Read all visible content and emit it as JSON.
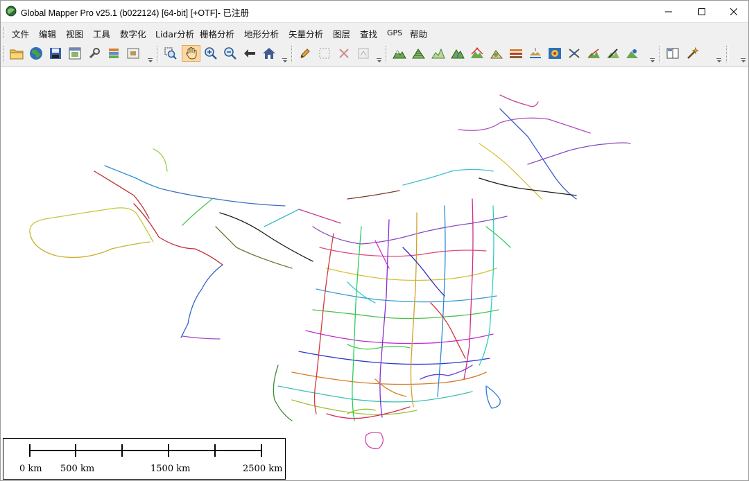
{
  "window": {
    "title": "Global Mapper Pro v25.1 (b022124) [64-bit] [+OTF]- 已注册",
    "controls": [
      "minimize-icon",
      "maximize-icon",
      "close-icon"
    ]
  },
  "menu": {
    "items": [
      "文件",
      "编辑",
      "视图",
      "工具",
      "数字化",
      "Lidar分析",
      "栅格分析",
      "地形分析",
      "矢量分析",
      "图层",
      "查找",
      "GPS",
      "帮助"
    ]
  },
  "toolbar": {
    "groups": [
      [
        "open-folder-icon",
        "globe-icon",
        "save-icon",
        "window-frame-icon",
        "wrench-icon",
        "layer-stack-icon",
        "thumbnail-icon"
      ],
      [
        "zoom-box-icon",
        "pan-hand-icon",
        "zoom-in-icon",
        "zoom-out-icon",
        "back-arrow-icon",
        "home-icon"
      ],
      [
        "pencil-icon",
        "select-box-icon",
        "delete-x-icon",
        "edit-vertex-icon"
      ],
      [
        "terrain-analysis-icon",
        "contour-icon",
        "elevation-profile-icon",
        "watershed-icon",
        "view-shed-icon",
        "slope-icon",
        "cut-fill-icon",
        "terrain-paint-icon",
        "line-of-sight-icon",
        "flight-path-icon",
        "path-profile-icon",
        "measure-icon",
        "contour-tool-icon"
      ],
      [
        "split-view-icon",
        "magic-wand-icon"
      ]
    ],
    "active": "pan-hand-icon"
  },
  "map": {
    "content": "rail-network-lines",
    "scale_bar": {
      "labels": [
        "0 km",
        "500 km",
        "1500 km",
        "2500 km"
      ],
      "tick_count": 6
    }
  },
  "colors": {
    "accent": "#fbd8a5",
    "menu_bg": "#f0f0f0",
    "map_bg": "#ffffff"
  }
}
